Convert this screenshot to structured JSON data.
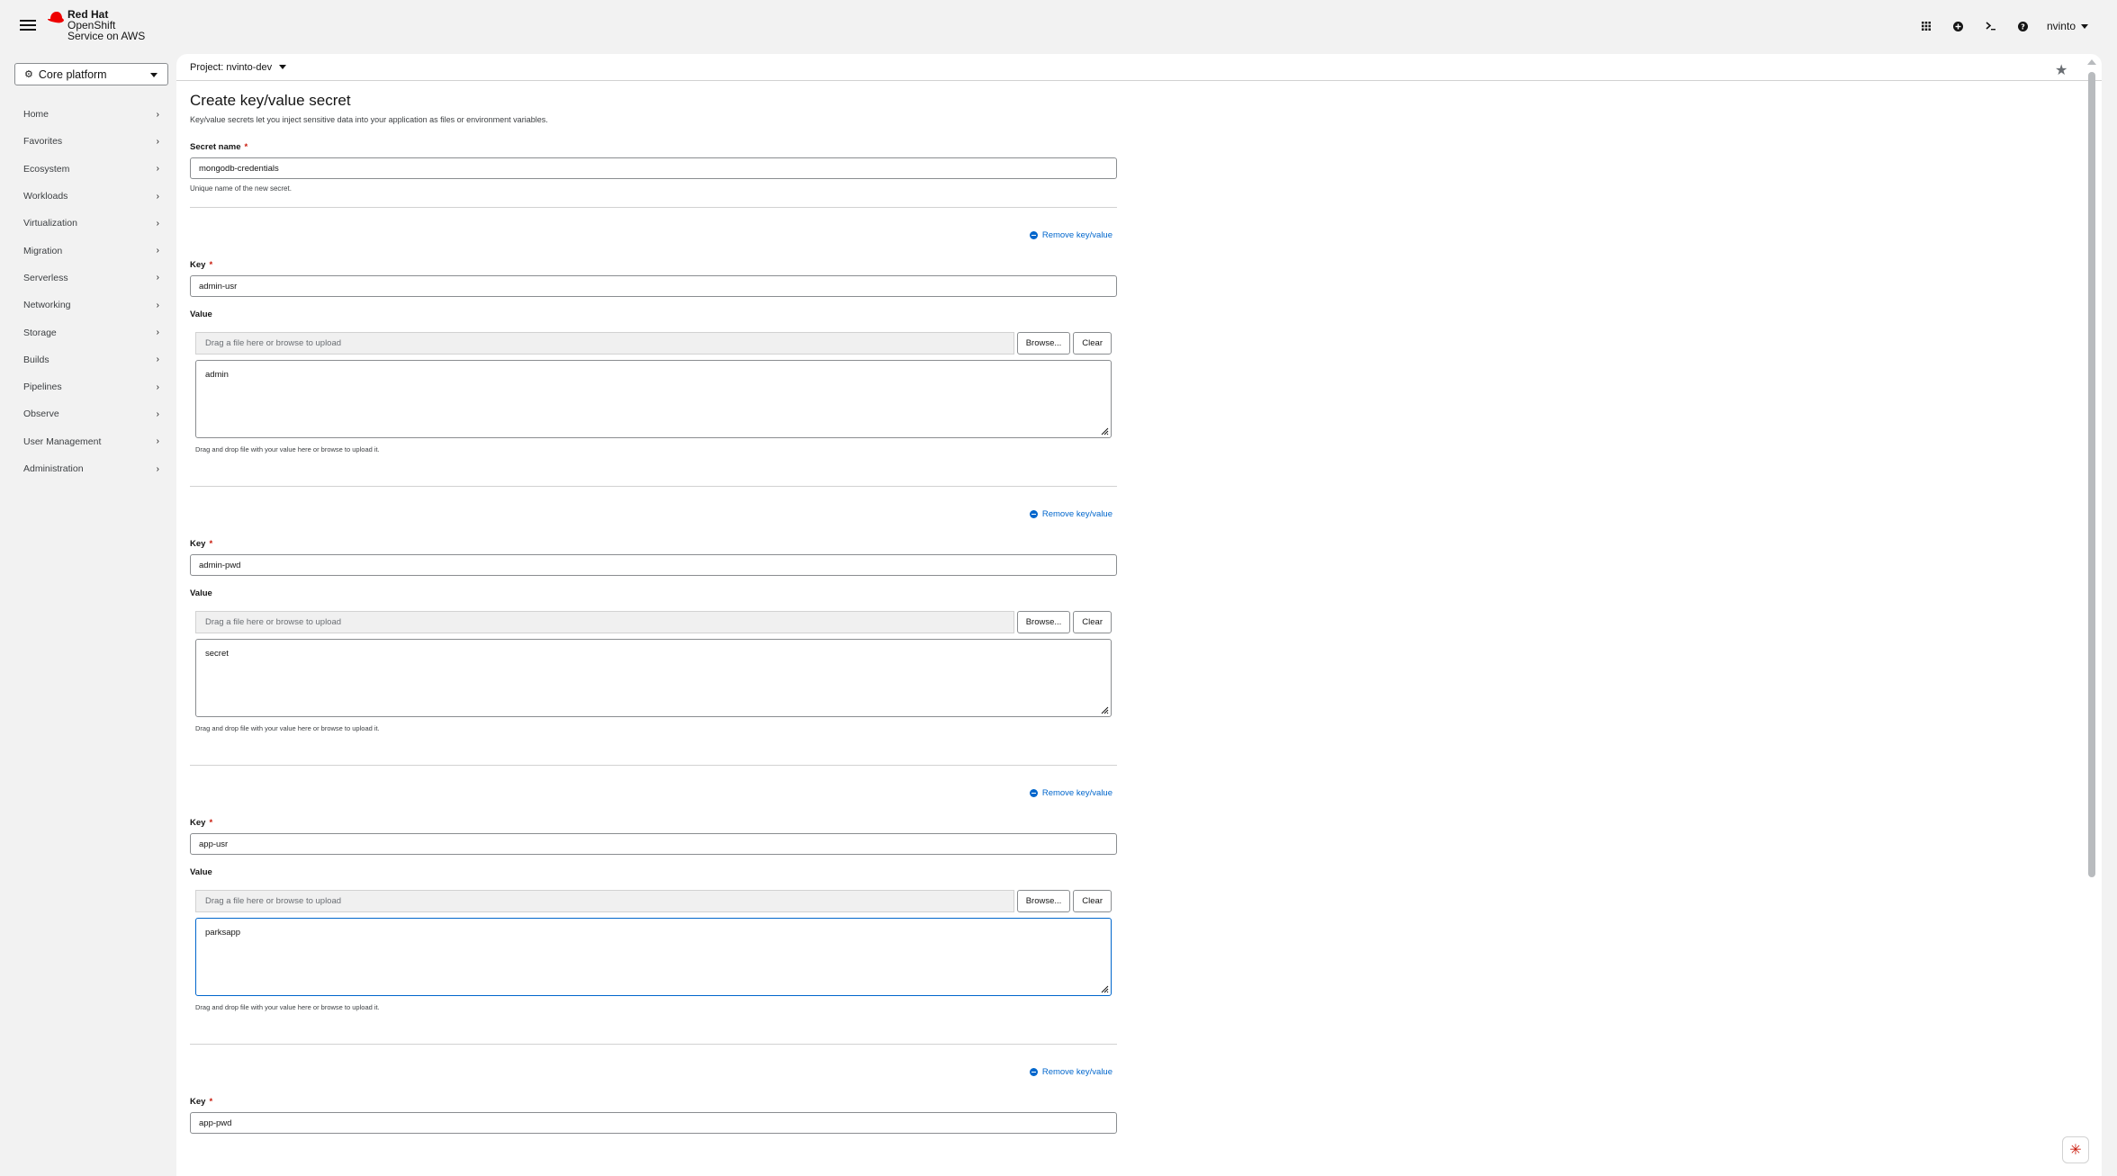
{
  "masthead": {
    "brand": {
      "line1": "Red Hat",
      "line2": "OpenShift",
      "line3": "Service on AWS"
    },
    "user": "nvinto"
  },
  "sidebar": {
    "perspective": "Core platform",
    "items": [
      {
        "label": "Home"
      },
      {
        "label": "Favorites"
      },
      {
        "label": "Ecosystem"
      },
      {
        "label": "Workloads"
      },
      {
        "label": "Virtualization"
      },
      {
        "label": "Migration"
      },
      {
        "label": "Serverless"
      },
      {
        "label": "Networking"
      },
      {
        "label": "Storage"
      },
      {
        "label": "Builds"
      },
      {
        "label": "Pipelines"
      },
      {
        "label": "Observe"
      },
      {
        "label": "User Management"
      },
      {
        "label": "Administration"
      }
    ]
  },
  "project": {
    "label": "Project: nvinto-dev"
  },
  "page": {
    "title": "Create key/value secret",
    "description": "Key/value secrets let you inject sensitive data into your application as files or environment variables."
  },
  "form": {
    "secret_name_label": "Secret name",
    "required_mark": "*",
    "secret_name_value": "mongodb-credentials",
    "secret_name_helper": "Unique name of the new secret.",
    "remove_label": "Remove key/value",
    "key_label": "Key",
    "value_label": "Value",
    "file_placeholder": "Drag a file here or browse to upload",
    "browse_label": "Browse...",
    "clear_label": "Clear",
    "drop_helper": "Drag and drop file with your value here or browse to upload it.",
    "pairs": [
      {
        "key": "admin-usr",
        "value": "admin"
      },
      {
        "key": "admin-pwd",
        "value": "secret"
      },
      {
        "key": "app-usr",
        "value": "parksapp"
      },
      {
        "key": "app-pwd"
      }
    ]
  }
}
